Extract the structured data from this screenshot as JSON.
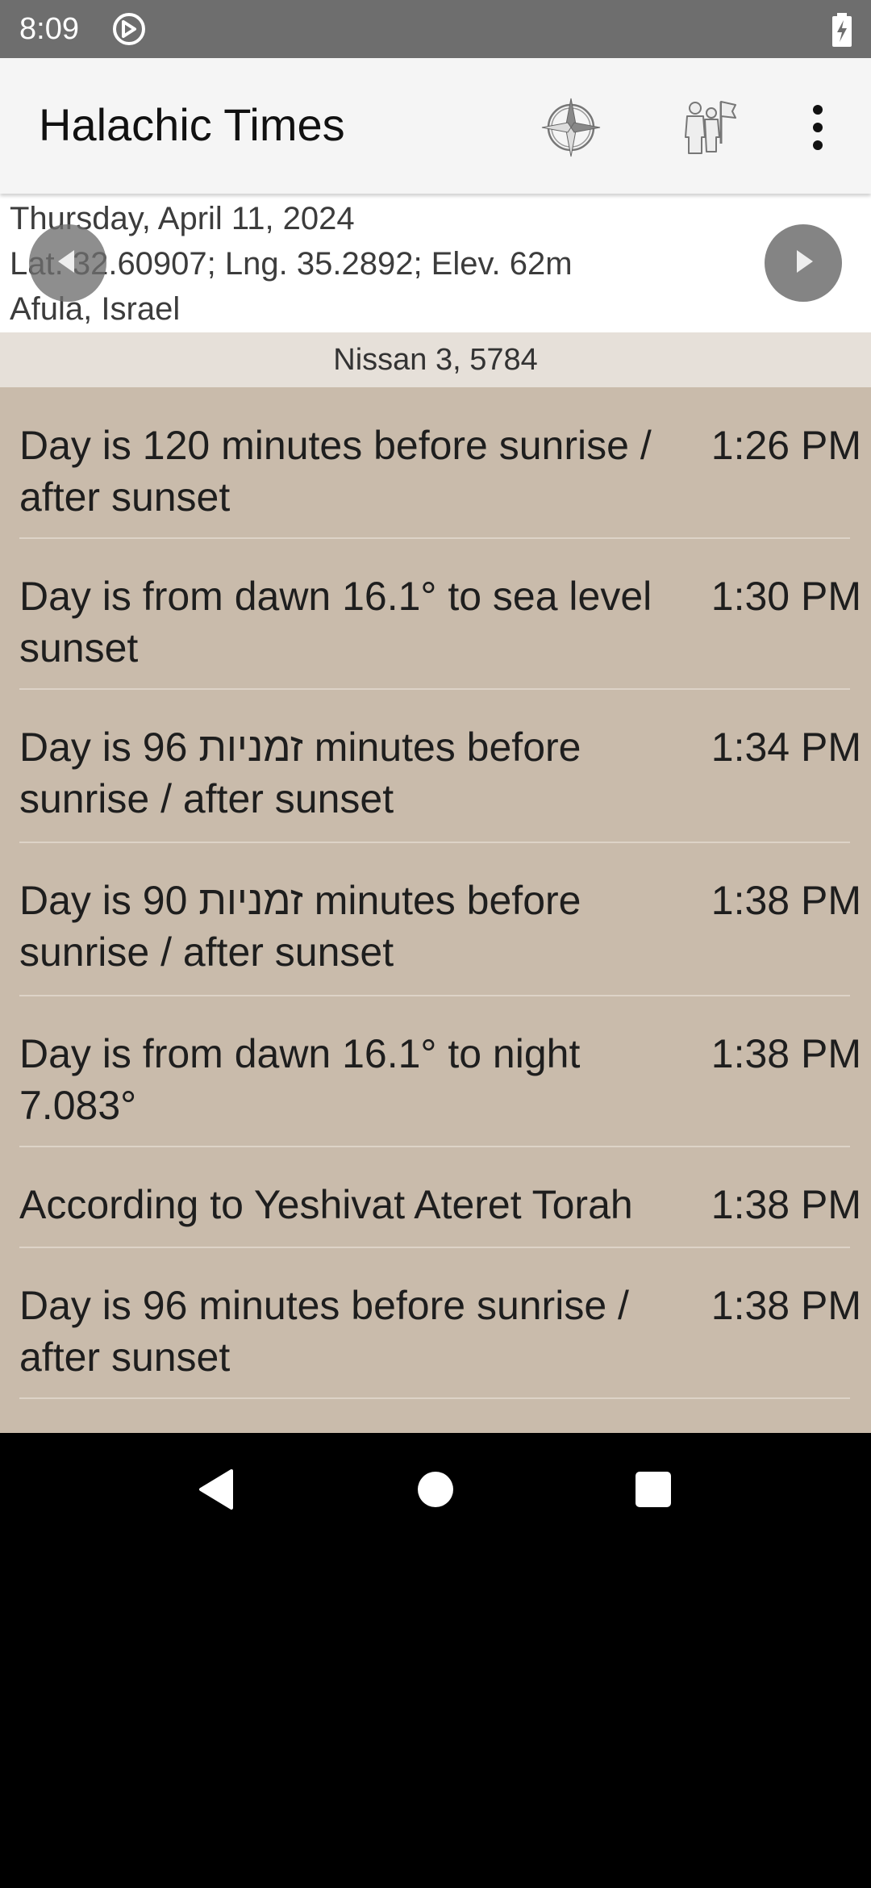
{
  "status_bar": {
    "time": "8:09"
  },
  "app_bar": {
    "title": "Halachic Times",
    "icons": [
      "compass-icon",
      "location-people-icon",
      "more-vert-icon"
    ]
  },
  "header": {
    "date": "Thursday, April 11, 2024",
    "coordinates": "Lat. 32.60907; Lng. 35.2892; Elev. 62m",
    "location": "Afula, Israel"
  },
  "hebrew_date": "Nissan 3, 5784",
  "times": [
    {
      "label": "Day is 120 minutes before sunrise / after sunset",
      "time": "1:26 PM"
    },
    {
      "label": "Day is from dawn 16.1° to sea level sunset",
      "time": "1:30 PM"
    },
    {
      "label": "Day is 96 זמניות minutes before sunrise / after sunset",
      "time": "1:34 PM"
    },
    {
      "label": "Day is 90 זמניות minutes before sunrise / after sunset",
      "time": "1:38 PM"
    },
    {
      "label": "Day is from dawn 16.1° to night 7.083°",
      "time": "1:38 PM"
    },
    {
      "label": "According to Yeshivat Ateret Torah",
      "time": "1:38 PM"
    },
    {
      "label": "Day is 96 minutes before sunrise / after sunset",
      "time": "1:38 PM"
    }
  ],
  "colors": {
    "status_bar": "#6e6e6e",
    "app_bar": "#f5f5f5",
    "hebrew_date_bar": "#e6e0d9",
    "list_background": "#c9bbab"
  }
}
